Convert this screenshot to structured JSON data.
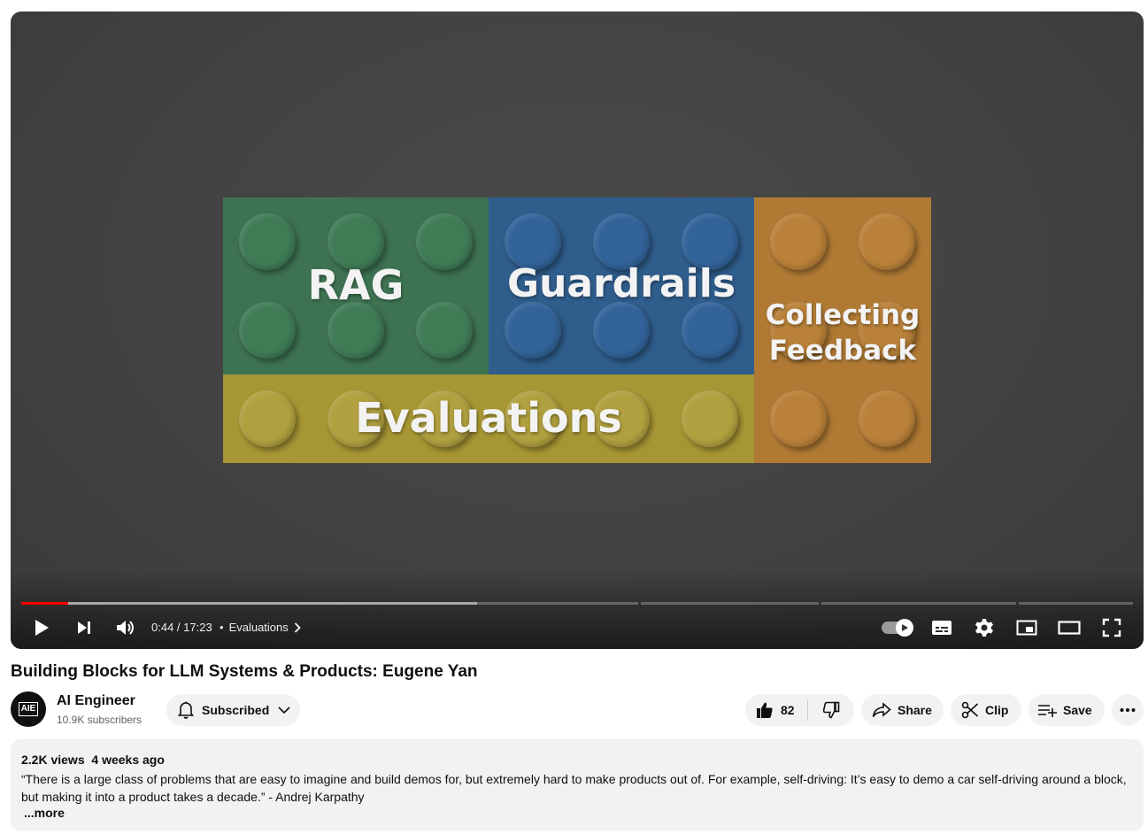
{
  "video": {
    "slide": {
      "rag_label": "RAG",
      "guardrails_label": "Guardrails",
      "collecting_label_line1": "Collecting",
      "collecting_label_line2": "Feedback",
      "evaluations_label": "Evaluations"
    },
    "progress": {
      "played_fraction": 0.042,
      "buffered_fraction": 0.41
    },
    "time": "0:44 / 17:23",
    "chapter_prefix": "•",
    "chapter": "Evaluations",
    "icons": [
      "play-icon",
      "next-icon",
      "volume-icon",
      "chevron-right-icon",
      "autoplay-toggle",
      "subtitles-icon",
      "settings-gear-icon",
      "miniplayer-icon",
      "theater-mode-icon",
      "fullscreen-icon"
    ]
  },
  "title": "Building Blocks for LLM Systems & Products: Eugene Yan",
  "channel": {
    "avatar_text": "AIE",
    "name": "AI Engineer",
    "subscribers": "10.9K subscribers",
    "subscribe_label": "Subscribed"
  },
  "actions": {
    "likes": "82",
    "share_label": "Share",
    "clip_label": "Clip",
    "save_label": "Save"
  },
  "description": {
    "views": "2.2K views",
    "age": "4 weeks ago",
    "text": "“There is a large class of problems that are easy to imagine and build demos for, but extremely hard to make products out of. For example, self-driving: It’s easy to demo a car self-driving around a block, but making it into a product takes a decade.” - Andrej Karpathy",
    "more_label": "...more"
  },
  "colors": {
    "progress_red": "#ff0000",
    "rag_green": "#3e7352",
    "guardrails_blue": "#2f5d8c",
    "feedback_orange": "#b07a34",
    "evaluations_yellow": "#a79634"
  }
}
